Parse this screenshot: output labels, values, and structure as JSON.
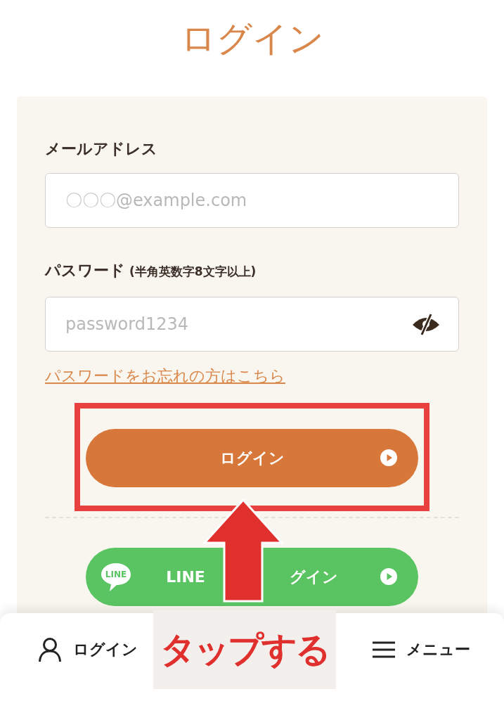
{
  "page_title": "ログイン",
  "form": {
    "email": {
      "label": "メールアドレス",
      "placeholder": "〇〇〇@example.com"
    },
    "password": {
      "label": "パスワード",
      "hint": "(半角英数字8文字以上)",
      "placeholder": "password1234"
    },
    "forgot_link": "パスワードをお忘れの方はこちら",
    "login_button": "ログイン",
    "line_button": {
      "logo": "LINE",
      "label_parts": [
        "LINE",
        "グイン"
      ]
    }
  },
  "bottom_nav": [
    {
      "kind": "account",
      "label": "ログイン"
    },
    {
      "kind": "menu",
      "label": "メニュー"
    }
  ],
  "annotation": {
    "label": "タップする"
  }
}
